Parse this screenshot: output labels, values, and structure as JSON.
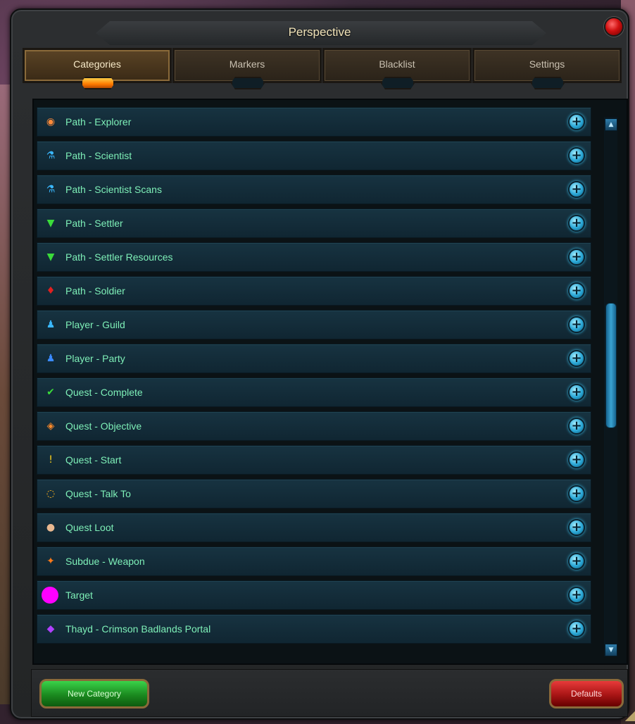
{
  "window": {
    "title": "Perspective"
  },
  "tabs": [
    {
      "label": "Categories",
      "active": true
    },
    {
      "label": "Markers",
      "active": false
    },
    {
      "label": "Blacklist",
      "active": false
    },
    {
      "label": "Settings",
      "active": false
    }
  ],
  "categories": [
    {
      "label": "Path - Explorer",
      "icon": "explorer-icon",
      "icon_color": "#ff8a3a"
    },
    {
      "label": "Path - Scientist",
      "icon": "scientist-icon",
      "icon_color": "#3ab8ff"
    },
    {
      "label": "Path - Scientist Scans",
      "icon": "scientist-scan-icon",
      "icon_color": "#3ab8ff"
    },
    {
      "label": "Path - Settler",
      "icon": "settler-icon",
      "icon_color": "#3adb3a"
    },
    {
      "label": "Path - Settler Resources",
      "icon": "settler-resources-icon",
      "icon_color": "#3adb3a"
    },
    {
      "label": "Path - Soldier",
      "icon": "soldier-icon",
      "icon_color": "#e02020"
    },
    {
      "label": "Player - Guild",
      "icon": "guild-icon",
      "icon_color": "#3ab8ff"
    },
    {
      "label": "Player - Party",
      "icon": "party-icon",
      "icon_color": "#3a8aff"
    },
    {
      "label": "Quest - Complete",
      "icon": "checkmark-icon",
      "icon_color": "#3adb3a"
    },
    {
      "label": "Quest - Objective",
      "icon": "objective-icon",
      "icon_color": "#ff8a2a"
    },
    {
      "label": "Quest - Start",
      "icon": "exclamation-icon",
      "icon_color": "#ffd21a"
    },
    {
      "label": "Quest - Talk To",
      "icon": "speech-bubble-icon",
      "icon_color": "#ffb31a"
    },
    {
      "label": "Quest Loot",
      "icon": "loot-bag-icon",
      "icon_color": "#e8b890"
    },
    {
      "label": "Subdue - Weapon",
      "icon": "weapon-icon",
      "icon_color": "#ff7a1a"
    },
    {
      "label": "Target",
      "icon": "target-dot-icon",
      "icon_color": "#ff00ff"
    },
    {
      "label": "Thayd - Crimson Badlands Portal",
      "icon": "portal-icon",
      "icon_color": "#b040ff"
    }
  ],
  "buttons": {
    "new_category": "New Category",
    "defaults": "Defaults"
  },
  "colors": {
    "accent_orange": "#ff7a00",
    "row_text": "#7ef0b8",
    "add_button": "#2aa7d6"
  }
}
